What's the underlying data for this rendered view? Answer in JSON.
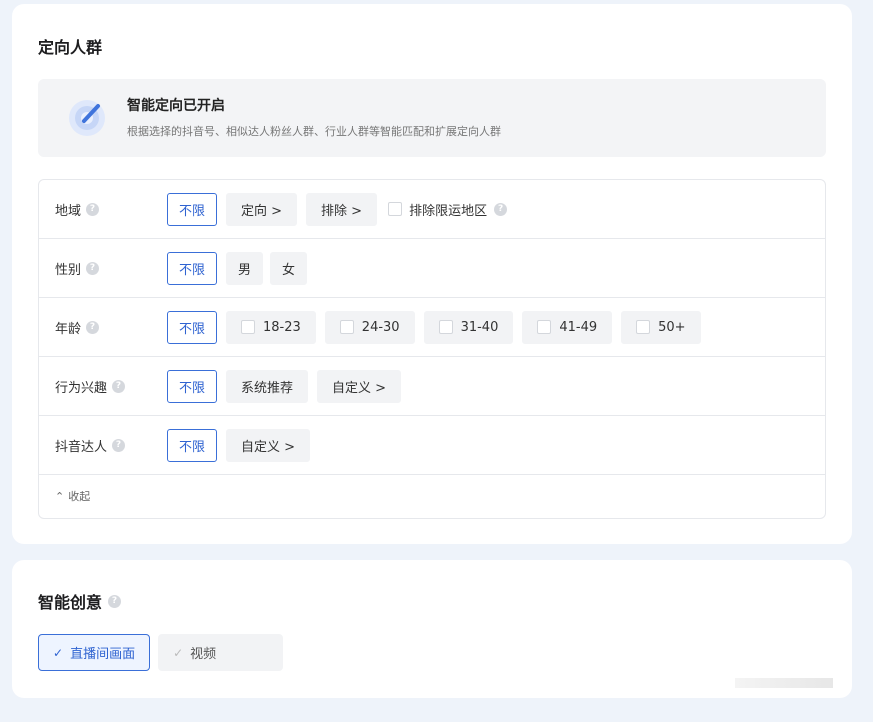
{
  "targeting": {
    "title": "定向人群",
    "smart": {
      "title": "智能定向已开启",
      "description": "根据选择的抖音号、相似达人粉丝人群、行业人群等智能匹配和扩展定向人群"
    },
    "rows": [
      {
        "label": "地域",
        "options": [
          "不限",
          "定向 >",
          "排除 >"
        ],
        "checkbox_label": "排除限运地区"
      },
      {
        "label": "性别",
        "options": [
          "不限",
          "男",
          "女"
        ]
      },
      {
        "label": "年龄",
        "options": [
          "不限",
          "18-23",
          "24-30",
          "31-40",
          "41-49",
          "50+"
        ]
      },
      {
        "label": "行为兴趣",
        "options": [
          "不限",
          "系统推荐",
          "自定义 >"
        ]
      },
      {
        "label": "抖音达人",
        "options": [
          "不限",
          "自定义 >"
        ]
      }
    ],
    "collapse_label": "收起",
    "selected_option": "不限"
  },
  "creative": {
    "title": "智能创意",
    "options": [
      {
        "label": "直播间画面",
        "checked": true
      },
      {
        "label": "视频",
        "checked": true
      }
    ]
  },
  "colors": {
    "accent": "#2f63d1",
    "accent_border": "#3a6fd8"
  },
  "icons": {
    "smart": "target-arrow-icon",
    "help": "question-circle-icon",
    "collapse": "chevron-double-up-icon",
    "check": "check-icon"
  }
}
